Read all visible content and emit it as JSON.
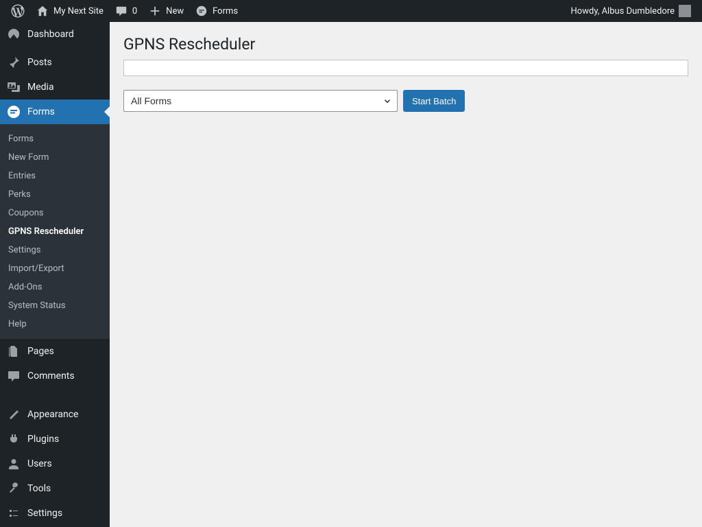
{
  "adminbar": {
    "site_name": "My Next Site",
    "comments_count": "0",
    "new_label": "New",
    "forms_label": "Forms",
    "howdy": "Howdy, Albus Dumbledore"
  },
  "sidebar": {
    "items": [
      {
        "id": "dashboard",
        "label": "Dashboard"
      },
      {
        "id": "posts",
        "label": "Posts"
      },
      {
        "id": "media",
        "label": "Media"
      },
      {
        "id": "forms",
        "label": "Forms",
        "current": true
      },
      {
        "id": "pages",
        "label": "Pages"
      },
      {
        "id": "comments",
        "label": "Comments"
      },
      {
        "id": "appearance",
        "label": "Appearance"
      },
      {
        "id": "plugins",
        "label": "Plugins"
      },
      {
        "id": "users",
        "label": "Users"
      },
      {
        "id": "tools",
        "label": "Tools"
      },
      {
        "id": "settings",
        "label": "Settings"
      }
    ],
    "forms_submenu": [
      {
        "label": "Forms"
      },
      {
        "label": "New Form"
      },
      {
        "label": "Entries"
      },
      {
        "label": "Perks"
      },
      {
        "label": "Coupons"
      },
      {
        "label": "GPNS Rescheduler",
        "current": true
      },
      {
        "label": "Settings"
      },
      {
        "label": "Import/Export"
      },
      {
        "label": "Add-Ons"
      },
      {
        "label": "System Status"
      },
      {
        "label": "Help"
      }
    ]
  },
  "main": {
    "heading": "GPNS Rescheduler",
    "form_selector_value": "All Forms",
    "start_button_label": "Start Batch"
  }
}
